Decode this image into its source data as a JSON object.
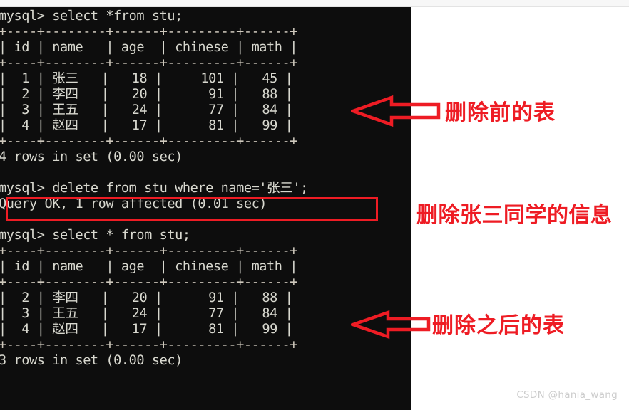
{
  "window": {
    "edge_color": "#f7f7f7",
    "terminal_bg": "#0d0d0d",
    "terminal_fg": "#d8d8cf",
    "accent_red": "#ee1c24"
  },
  "terminal": {
    "lines": [
      "mysql> select *from stu;",
      "+----+--------+------+---------+------+",
      "| id | name   | age  | chinese | math |",
      "+----+--------+------+---------+------+",
      "|  1 | 张三   |   18 |     101 |   45 |",
      "|  2 | 李四   |   20 |      91 |   88 |",
      "|  3 | 王五   |   24 |      77 |   84 |",
      "|  4 | 赵四   |   17 |      81 |   99 |",
      "+----+--------+------+---------+------+",
      "4 rows in set (0.00 sec)",
      "",
      "mysql> delete from stu where name='张三';",
      "Query OK, 1 row affected (0.01 sec)",
      "",
      "mysql> select * from stu;",
      "+----+--------+------+---------+------+",
      "| id | name   | age  | chinese | math |",
      "+----+--------+------+---------+------+",
      "|  2 | 李四   |   20 |      91 |   88 |",
      "|  3 | 王五   |   24 |      77 |   84 |",
      "|  4 | 赵四   |   17 |      81 |   99 |",
      "+----+--------+------+---------+------+",
      "3 rows in set (0.00 sec)"
    ],
    "prompt": "mysql>",
    "queries": {
      "select_before": "select *from stu;",
      "delete": "delete from stu where name='张三';",
      "select_after": "select * from stu;"
    },
    "result_status": {
      "before": "4 rows in set (0.00 sec)",
      "delete": "Query OK, 1 row affected (0.01 sec)",
      "after": "3 rows in set (0.00 sec)"
    },
    "table_columns": [
      "id",
      "name",
      "age",
      "chinese",
      "math"
    ],
    "table_before": [
      [
        "1",
        "张三",
        "18",
        "101",
        "45"
      ],
      [
        "2",
        "李四",
        "20",
        "91",
        "88"
      ],
      [
        "3",
        "王五",
        "24",
        "77",
        "84"
      ],
      [
        "4",
        "赵四",
        "17",
        "81",
        "99"
      ]
    ],
    "table_after": [
      [
        "2",
        "李四",
        "20",
        "91",
        "88"
      ],
      [
        "3",
        "王五",
        "24",
        "77",
        "84"
      ],
      [
        "4",
        "赵四",
        "17",
        "81",
        "99"
      ]
    ]
  },
  "annotations": {
    "before_table": "删除前的表",
    "delete_statement": "删除张三同学的信息",
    "after_table": "删除之后的表"
  },
  "watermark": {
    "text": "CSDN @hania_wang"
  }
}
